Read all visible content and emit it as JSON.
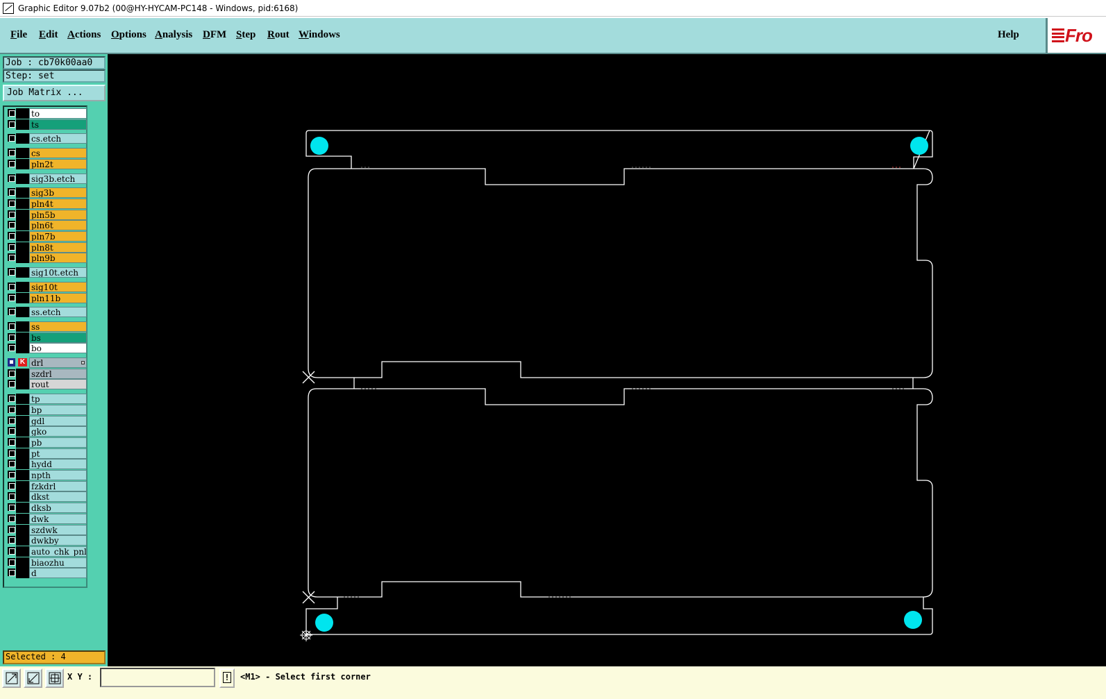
{
  "window": {
    "title": "Graphic Editor 9.07b2 (00@HY-HYCAM-PC148 - Windows, pid:6168)"
  },
  "menu": {
    "items": [
      {
        "label": "File",
        "key": "F",
        "rest": "ile"
      },
      {
        "label": "Edit",
        "key": "E",
        "rest": "dit"
      },
      {
        "label": "Actions",
        "key": "A",
        "rest": "ctions"
      },
      {
        "label": "Options",
        "key": "O",
        "rest": "ptions"
      },
      {
        "label": "Analysis",
        "key": "A",
        "rest": "nalysis"
      },
      {
        "label": "DFM",
        "key": "D",
        "rest": "FM"
      },
      {
        "label": "Step",
        "key": "S",
        "rest": "tep"
      },
      {
        "label": "Rout",
        "key": "R",
        "rest": "out"
      },
      {
        "label": "Windows",
        "key": "W",
        "rest": "indows"
      }
    ],
    "help": "Help",
    "logo_text": "Fro"
  },
  "job": {
    "label": "Job : cb70k00aa0",
    "step": "Step: set",
    "matrix_button": "Job Matrix ..."
  },
  "layers": [
    {
      "name": "to",
      "color": "white"
    },
    {
      "name": "ts",
      "color": "green"
    },
    {
      "name": "cs.etch",
      "color": "cyan"
    },
    {
      "name": "cs",
      "color": "orange"
    },
    {
      "name": "pln2t",
      "color": "orange"
    },
    {
      "name": "sig3b.etch",
      "color": "cyan"
    },
    {
      "name": "sig3b",
      "color": "orange"
    },
    {
      "name": "pln4t",
      "color": "orange"
    },
    {
      "name": "pln5b",
      "color": "orange"
    },
    {
      "name": "pln6t",
      "color": "orange"
    },
    {
      "name": "pln7b",
      "color": "orange"
    },
    {
      "name": "pln8t",
      "color": "orange"
    },
    {
      "name": "pln9b",
      "color": "orange"
    },
    {
      "name": "sig10t.etch",
      "color": "cyan"
    },
    {
      "name": "sig10t",
      "color": "orange"
    },
    {
      "name": "pln11b",
      "color": "orange"
    },
    {
      "name": "ss.etch",
      "color": "cyan"
    },
    {
      "name": "ss",
      "color": "orange"
    },
    {
      "name": "bs",
      "color": "green"
    },
    {
      "name": "bo",
      "color": "white"
    },
    {
      "name": "drl",
      "color": "gray",
      "active": true
    },
    {
      "name": "szdrl",
      "color": "gray"
    },
    {
      "name": "rout",
      "color": "lightgray"
    },
    {
      "name": "tp",
      "color": "cyan"
    },
    {
      "name": "bp",
      "color": "cyan"
    },
    {
      "name": "gdl",
      "color": "cyan"
    },
    {
      "name": "gko",
      "color": "cyan"
    },
    {
      "name": "pb",
      "color": "cyan"
    },
    {
      "name": "pt",
      "color": "cyan"
    },
    {
      "name": "hydd",
      "color": "cyan"
    },
    {
      "name": "npth",
      "color": "cyan"
    },
    {
      "name": "fzkdrl",
      "color": "cyan"
    },
    {
      "name": "dkst",
      "color": "cyan"
    },
    {
      "name": "dksb",
      "color": "cyan"
    },
    {
      "name": "dwk",
      "color": "cyan"
    },
    {
      "name": "szdwk",
      "color": "cyan"
    },
    {
      "name": "dwkby",
      "color": "cyan"
    },
    {
      "name": "auto_chk_pnl",
      "color": "cyan"
    },
    {
      "name": "biaozhu",
      "color": "cyan"
    },
    {
      "name": "d",
      "color": "cyan"
    }
  ],
  "selected": "Selected : 4",
  "status": {
    "xy_label": "X Y :",
    "xy_value": "",
    "warn": "!",
    "prompt": "<M1> - Select first corner"
  },
  "colors": {
    "panel_bg": "#54d0b0",
    "menu_bg": "#a3dcdc",
    "canvas_bg": "#000000",
    "outline": "#ffffff",
    "fiducial": "#00e5ee",
    "status_bg": "#fbfbdd"
  },
  "icons": {
    "app": "graphic-editor-icon",
    "zoom_box": "zoom-box-icon",
    "zoom_fit": "zoom-fit-icon",
    "grid": "grid-icon"
  }
}
